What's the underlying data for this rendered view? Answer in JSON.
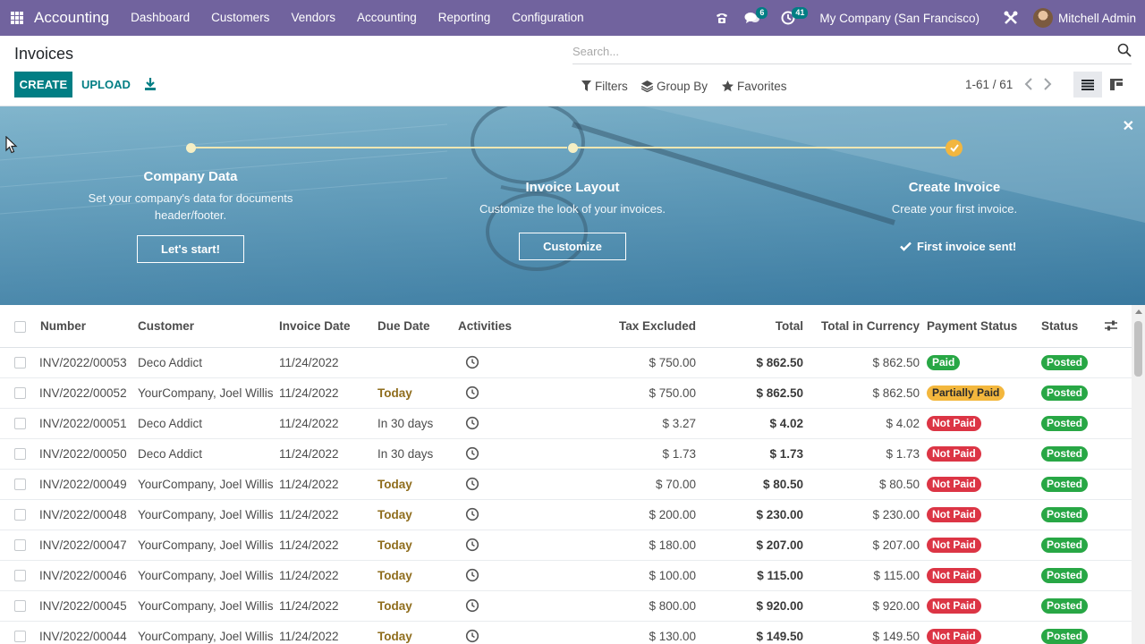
{
  "navbar": {
    "brand": "Accounting",
    "menu": [
      "Dashboard",
      "Customers",
      "Vendors",
      "Accounting",
      "Reporting",
      "Configuration"
    ],
    "messages_count": "6",
    "activities_count": "41",
    "company": "My Company (San Francisco)",
    "user": "Mitchell Admin",
    "bg_color": "#71639e"
  },
  "control": {
    "title": "Invoices",
    "create_label": "CREATE",
    "upload_label": "UPLOAD",
    "search_placeholder": "Search...",
    "filters_label": "Filters",
    "groupby_label": "Group By",
    "favorites_label": "Favorites",
    "pager": "1-61 / 61"
  },
  "banner": {
    "steps": [
      {
        "title": "Company Data",
        "desc_line1": "Set your company's data for documents",
        "desc_line2": "header/footer.",
        "button": "Let's start!"
      },
      {
        "title": "Invoice Layout",
        "desc_line1": "Customize the look of your invoices.",
        "button": "Customize"
      },
      {
        "title": "Create Invoice",
        "desc_line1": "Create your first invoice.",
        "done_label": "First invoice sent!"
      }
    ]
  },
  "table": {
    "headers": {
      "number": "Number",
      "customer": "Customer",
      "invoice_date": "Invoice Date",
      "due_date": "Due Date",
      "activities": "Activities",
      "tax_excluded": "Tax Excluded",
      "total": "Total",
      "total_currency": "Total in Currency",
      "payment_status": "Payment Status",
      "status": "Status"
    },
    "rows": [
      {
        "number": "INV/2022/00053",
        "customer": "Deco Addict",
        "date": "11/24/2022",
        "due": "",
        "tax_excl": "$ 750.00",
        "total": "$ 862.50",
        "total_cur": "$ 862.50",
        "payment": "Paid",
        "status": "Posted"
      },
      {
        "number": "INV/2022/00052",
        "customer": "YourCompany, Joel Willis",
        "date": "11/24/2022",
        "due": "Today",
        "tax_excl": "$ 750.00",
        "total": "$ 862.50",
        "total_cur": "$ 862.50",
        "payment": "Partially Paid",
        "status": "Posted"
      },
      {
        "number": "INV/2022/00051",
        "customer": "Deco Addict",
        "date": "11/24/2022",
        "due": "In 30 days",
        "tax_excl": "$ 3.27",
        "total": "$ 4.02",
        "total_cur": "$ 4.02",
        "payment": "Not Paid",
        "status": "Posted"
      },
      {
        "number": "INV/2022/00050",
        "customer": "Deco Addict",
        "date": "11/24/2022",
        "due": "In 30 days",
        "tax_excl": "$ 1.73",
        "total": "$ 1.73",
        "total_cur": "$ 1.73",
        "payment": "Not Paid",
        "status": "Posted"
      },
      {
        "number": "INV/2022/00049",
        "customer": "YourCompany, Joel Willis",
        "date": "11/24/2022",
        "due": "Today",
        "tax_excl": "$ 70.00",
        "total": "$ 80.50",
        "total_cur": "$ 80.50",
        "payment": "Not Paid",
        "status": "Posted"
      },
      {
        "number": "INV/2022/00048",
        "customer": "YourCompany, Joel Willis",
        "date": "11/24/2022",
        "due": "Today",
        "tax_excl": "$ 200.00",
        "total": "$ 230.00",
        "total_cur": "$ 230.00",
        "payment": "Not Paid",
        "status": "Posted"
      },
      {
        "number": "INV/2022/00047",
        "customer": "YourCompany, Joel Willis",
        "date": "11/24/2022",
        "due": "Today",
        "tax_excl": "$ 180.00",
        "total": "$ 207.00",
        "total_cur": "$ 207.00",
        "payment": "Not Paid",
        "status": "Posted"
      },
      {
        "number": "INV/2022/00046",
        "customer": "YourCompany, Joel Willis",
        "date": "11/24/2022",
        "due": "Today",
        "tax_excl": "$ 100.00",
        "total": "$ 115.00",
        "total_cur": "$ 115.00",
        "payment": "Not Paid",
        "status": "Posted"
      },
      {
        "number": "INV/2022/00045",
        "customer": "YourCompany, Joel Willis",
        "date": "11/24/2022",
        "due": "Today",
        "tax_excl": "$ 800.00",
        "total": "$ 920.00",
        "total_cur": "$ 920.00",
        "payment": "Not Paid",
        "status": "Posted"
      },
      {
        "number": "INV/2022/00044",
        "customer": "YourCompany, Joel Willis",
        "date": "11/24/2022",
        "due": "Today",
        "tax_excl": "$ 130.00",
        "total": "$ 149.50",
        "total_cur": "$ 149.50",
        "payment": "Not Paid",
        "status": "Posted"
      }
    ]
  },
  "colors": {
    "primary": "#017e84",
    "paid": "#28a745",
    "partially_paid": "#f3b73d",
    "not_paid": "#dc3545",
    "posted": "#28a745",
    "due_today": "#8f6d1d"
  }
}
